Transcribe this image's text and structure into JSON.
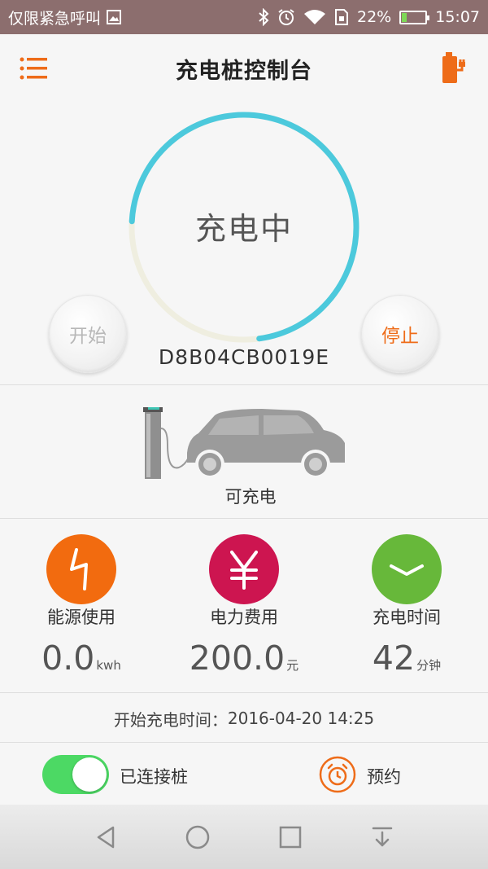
{
  "status_bar": {
    "carrier": "仅限紧急呼叫",
    "battery_percent": "22%",
    "battery_level": 0.22,
    "time": "15:07",
    "icons": [
      "image-icon",
      "bluetooth-icon",
      "alarm-icon",
      "wifi-icon",
      "sim-icon",
      "battery-icon"
    ]
  },
  "header": {
    "title": "充电桩控制台",
    "menu_icon": "menu-icon",
    "plug_icon": "charger-plug-icon"
  },
  "charging": {
    "status": "充电中",
    "progress": 0.72,
    "start_label": "开始",
    "stop_label": "停止",
    "device_id": "D8B04CB0019E"
  },
  "car": {
    "status": "可充电"
  },
  "stats": [
    {
      "label": "能源使用",
      "value": "0.0",
      "unit": "kwh",
      "icon": "lightning-icon",
      "color": "#f26b0f"
    },
    {
      "label": "电力费用",
      "value": "200.0",
      "unit": "元",
      "icon": "yen-icon",
      "color": "#cd1550"
    },
    {
      "label": "充电时间",
      "value": "42",
      "unit": "分钟",
      "icon": "clock-icon",
      "color": "#67b83a"
    }
  ],
  "start_time": {
    "label": "开始充电时间：",
    "value": "2016-04-20 14:25"
  },
  "controls": {
    "toggle_label": "已连接桩",
    "toggle_on": true,
    "reserve_label": "预约"
  },
  "colors": {
    "accent": "#ee6c19",
    "ring_active": "#4cc9dc",
    "ring_track": "#efeee0",
    "toggle_on": "#4cd964"
  }
}
